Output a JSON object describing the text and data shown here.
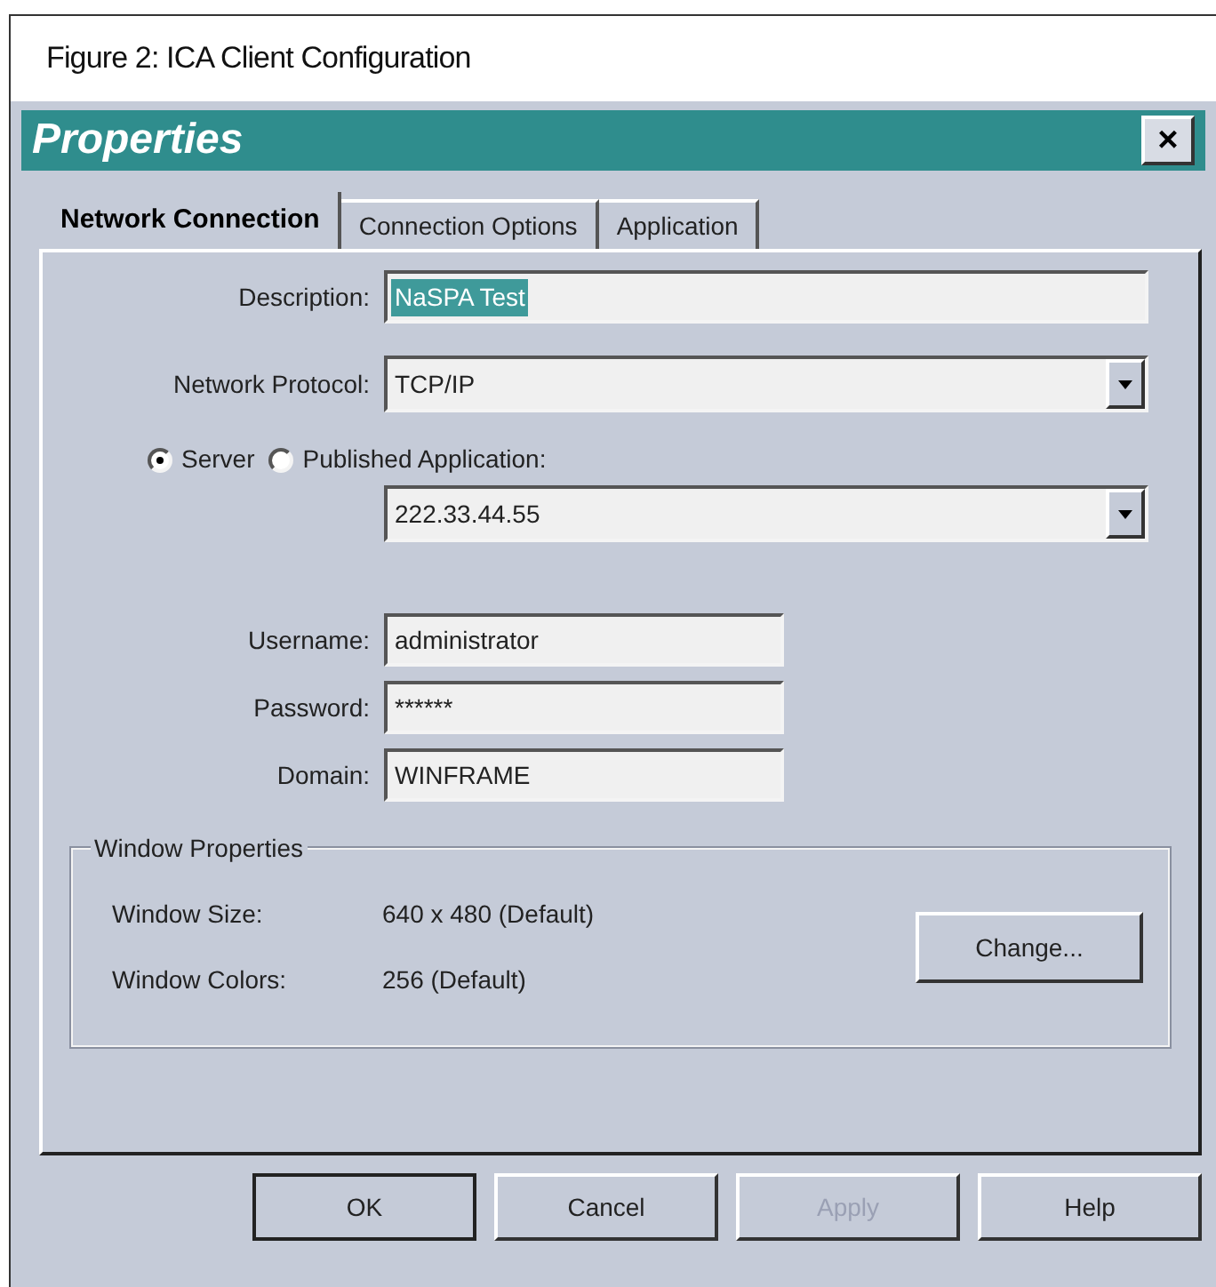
{
  "figure_caption": "Figure 2: ICA Client Configuration",
  "window": {
    "title": "Properties",
    "close": "×"
  },
  "tabs": [
    {
      "label": "Network Connection",
      "selected": true
    },
    {
      "label": "Connection Options",
      "selected": false
    },
    {
      "label": "Application",
      "selected": false
    }
  ],
  "description": {
    "label": "Description:",
    "value": "NaSPA Test",
    "highlighted": true
  },
  "network_protocol": {
    "label": "Network Protocol:",
    "value": "TCP/IP"
  },
  "radios": [
    {
      "label": "Server",
      "selected": true
    },
    {
      "label": "Published Application:",
      "selected": false
    }
  ],
  "server_address": {
    "value": "222.33.44.55"
  },
  "credentials": [
    {
      "label": "Username:",
      "value": "administrator"
    },
    {
      "label": "Password:",
      "value": "******"
    },
    {
      "label": "Domain:",
      "value": "WINFRAME"
    }
  ],
  "window_properties": {
    "title": "Window Properties",
    "rows": [
      {
        "label": "Window Size:",
        "value": "640 x 480 (Default)"
      },
      {
        "label": "Window Colors:",
        "value": "256 (Default)"
      }
    ],
    "button": "Change..."
  },
  "buttons": [
    {
      "label": "OK",
      "disabled": false,
      "default": true
    },
    {
      "label": "Cancel",
      "disabled": false,
      "default": false
    },
    {
      "label": "Apply",
      "disabled": true,
      "default": false
    },
    {
      "label": "Help",
      "disabled": false,
      "default": false
    }
  ]
}
